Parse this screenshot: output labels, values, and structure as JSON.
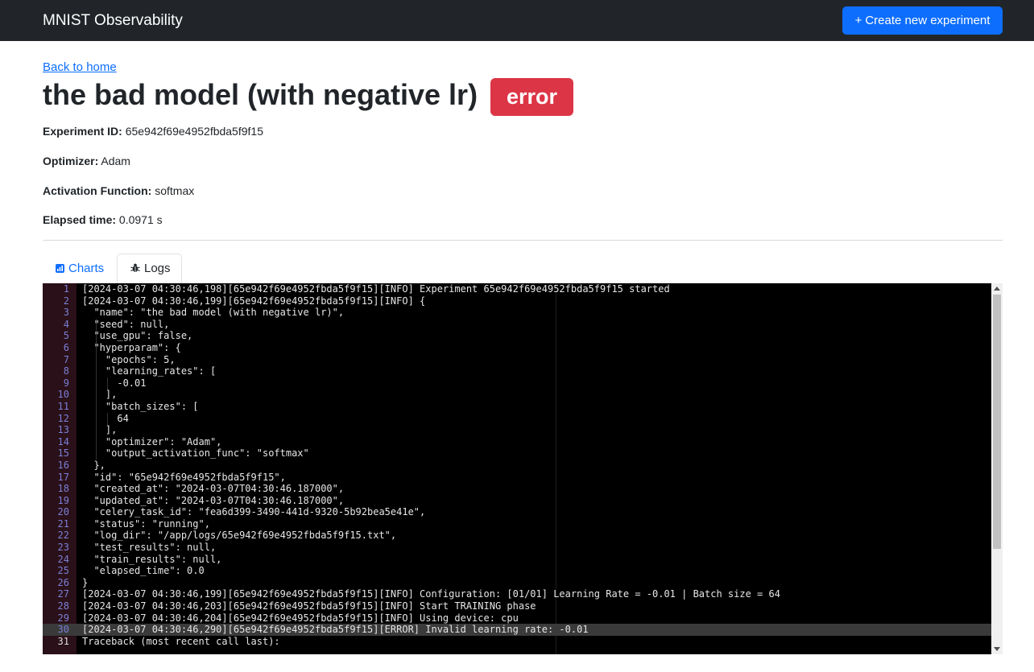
{
  "navbar": {
    "brand": "MNIST Observability",
    "new_experiment_label": "Create new experiment",
    "plus_icon": "+"
  },
  "back_link": "Back to home",
  "experiment": {
    "name": "the bad model (with negative lr)",
    "status": "error",
    "fields": [
      {
        "label": "Experiment ID:",
        "value": "65e942f69e4952fbda5f9f15"
      },
      {
        "label": "Optimizer:",
        "value": "Adam"
      },
      {
        "label": "Activation Function:",
        "value": "softmax"
      },
      {
        "label": "Elapsed time:",
        "value": "0.0971 s"
      }
    ]
  },
  "tabs": [
    {
      "label": "Charts",
      "icon": "bar-chart-icon",
      "active": false
    },
    {
      "label": "Logs",
      "icon": "bug-icon",
      "active": true
    }
  ],
  "log_lines": [
    {
      "n": "1",
      "text": "[2024-03-07 04:30:46,198][65e942f69e4952fbda5f9f15][INFO] Experiment 65e942f69e4952fbda5f9f15 started"
    },
    {
      "n": "2",
      "text": "[2024-03-07 04:30:46,199][65e942f69e4952fbda5f9f15][INFO] {"
    },
    {
      "n": "3",
      "text": "  \"name\": \"the bad model (with negative lr)\","
    },
    {
      "n": "4",
      "text": "  \"seed\": null,"
    },
    {
      "n": "5",
      "text": "  \"use_gpu\": false,"
    },
    {
      "n": "6",
      "text": "  \"hyperparam\": {"
    },
    {
      "n": "7",
      "text": "    \"epochs\": 5,"
    },
    {
      "n": "8",
      "text": "    \"learning_rates\": ["
    },
    {
      "n": "9",
      "text": "      -0.01"
    },
    {
      "n": "10",
      "text": "    ],"
    },
    {
      "n": "11",
      "text": "    \"batch_sizes\": ["
    },
    {
      "n": "12",
      "text": "      64"
    },
    {
      "n": "13",
      "text": "    ],"
    },
    {
      "n": "14",
      "text": "    \"optimizer\": \"Adam\","
    },
    {
      "n": "15",
      "text": "    \"output_activation_func\": \"softmax\""
    },
    {
      "n": "16",
      "text": "  },"
    },
    {
      "n": "17",
      "text": "  \"id\": \"65e942f69e4952fbda5f9f15\","
    },
    {
      "n": "18",
      "text": "  \"created_at\": \"2024-03-07T04:30:46.187000\","
    },
    {
      "n": "19",
      "text": "  \"updated_at\": \"2024-03-07T04:30:46.187000\","
    },
    {
      "n": "20",
      "text": "  \"celery_task_id\": \"fea6d399-3490-441d-9320-5b92bea5e41e\","
    },
    {
      "n": "21",
      "text": "  \"status\": \"running\","
    },
    {
      "n": "22",
      "text": "  \"log_dir\": \"/app/logs/65e942f69e4952fbda5f9f15.txt\","
    },
    {
      "n": "23",
      "text": "  \"test_results\": null,"
    },
    {
      "n": "24",
      "text": "  \"train_results\": null,"
    },
    {
      "n": "25",
      "text": "  \"elapsed_time\": 0.0"
    },
    {
      "n": "26",
      "text": "}"
    },
    {
      "n": "27",
      "text": "[2024-03-07 04:30:46,199][65e942f69e4952fbda5f9f15][INFO] Configuration: [01/01] Learning Rate = -0.01 | Batch size = 64"
    },
    {
      "n": "28",
      "text": "[2024-03-07 04:30:46,203][65e942f69e4952fbda5f9f15][INFO] Start TRAINING phase"
    },
    {
      "n": "29",
      "text": "[2024-03-07 04:30:46,204][65e942f69e4952fbda5f9f15][INFO] Using device: cpu"
    },
    {
      "n": "30",
      "text": "[2024-03-07 04:30:46,290][65e942f69e4952fbda5f9f15][ERROR] Invalid learning rate: -0.01"
    },
    {
      "n": "31",
      "text": "Traceback (most recent call last):"
    }
  ],
  "highlighted_line": "30",
  "cursor_line": "31",
  "colors": {
    "navbar": "#212529",
    "primary": "#0d6efd",
    "danger": "#dc3545",
    "editor_bg": "#000000",
    "gutter_bg": "#2a1018",
    "line_number": "#7b7fd6"
  }
}
